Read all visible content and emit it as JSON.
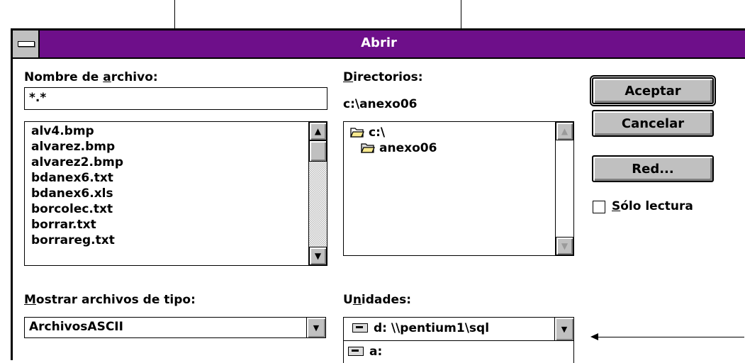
{
  "dialog": {
    "title": "Abrir"
  },
  "filename": {
    "label_pre": "Nombre de ",
    "label_ul": "a",
    "label_post": "rchivo:",
    "value": "*.*"
  },
  "files": [
    "alv4.bmp",
    "alvarez.bmp",
    "alvarez2.bmp",
    "bdanex6.txt",
    "bdanex6.xls",
    "borcolec.txt",
    "borrar.txt",
    "borrareg.txt"
  ],
  "directories": {
    "label_ul": "D",
    "label_post": "irectorios:",
    "current": "c:\\anexo06",
    "items": [
      "c:\\",
      "anexo06"
    ]
  },
  "filetype": {
    "label_ul": "M",
    "label_post": "ostrar archivos de tipo:",
    "value": "ArchivosASCII"
  },
  "drives": {
    "label_pre": "U",
    "label_ul": "n",
    "label_post": "idades:",
    "value": "d: \\\\pentium1\\sql",
    "dropdown_item": "a:"
  },
  "buttons": {
    "ok": "Aceptar",
    "cancel": "Cancelar",
    "network": "Red..."
  },
  "readonly": {
    "label_ul": "S",
    "label_post": "ólo lectura",
    "checked": false
  },
  "colors": {
    "titlebar": "#6e0f8a",
    "button_face": "#c0c0c0",
    "folder": "#f7e98f"
  },
  "icons": {
    "scroll_up": "▲",
    "scroll_down": "▼",
    "combo_arrow": "▼",
    "system_menu": "system-menu-icon",
    "folder_open": "folder-open-icon",
    "drive": "network-drive-icon"
  }
}
